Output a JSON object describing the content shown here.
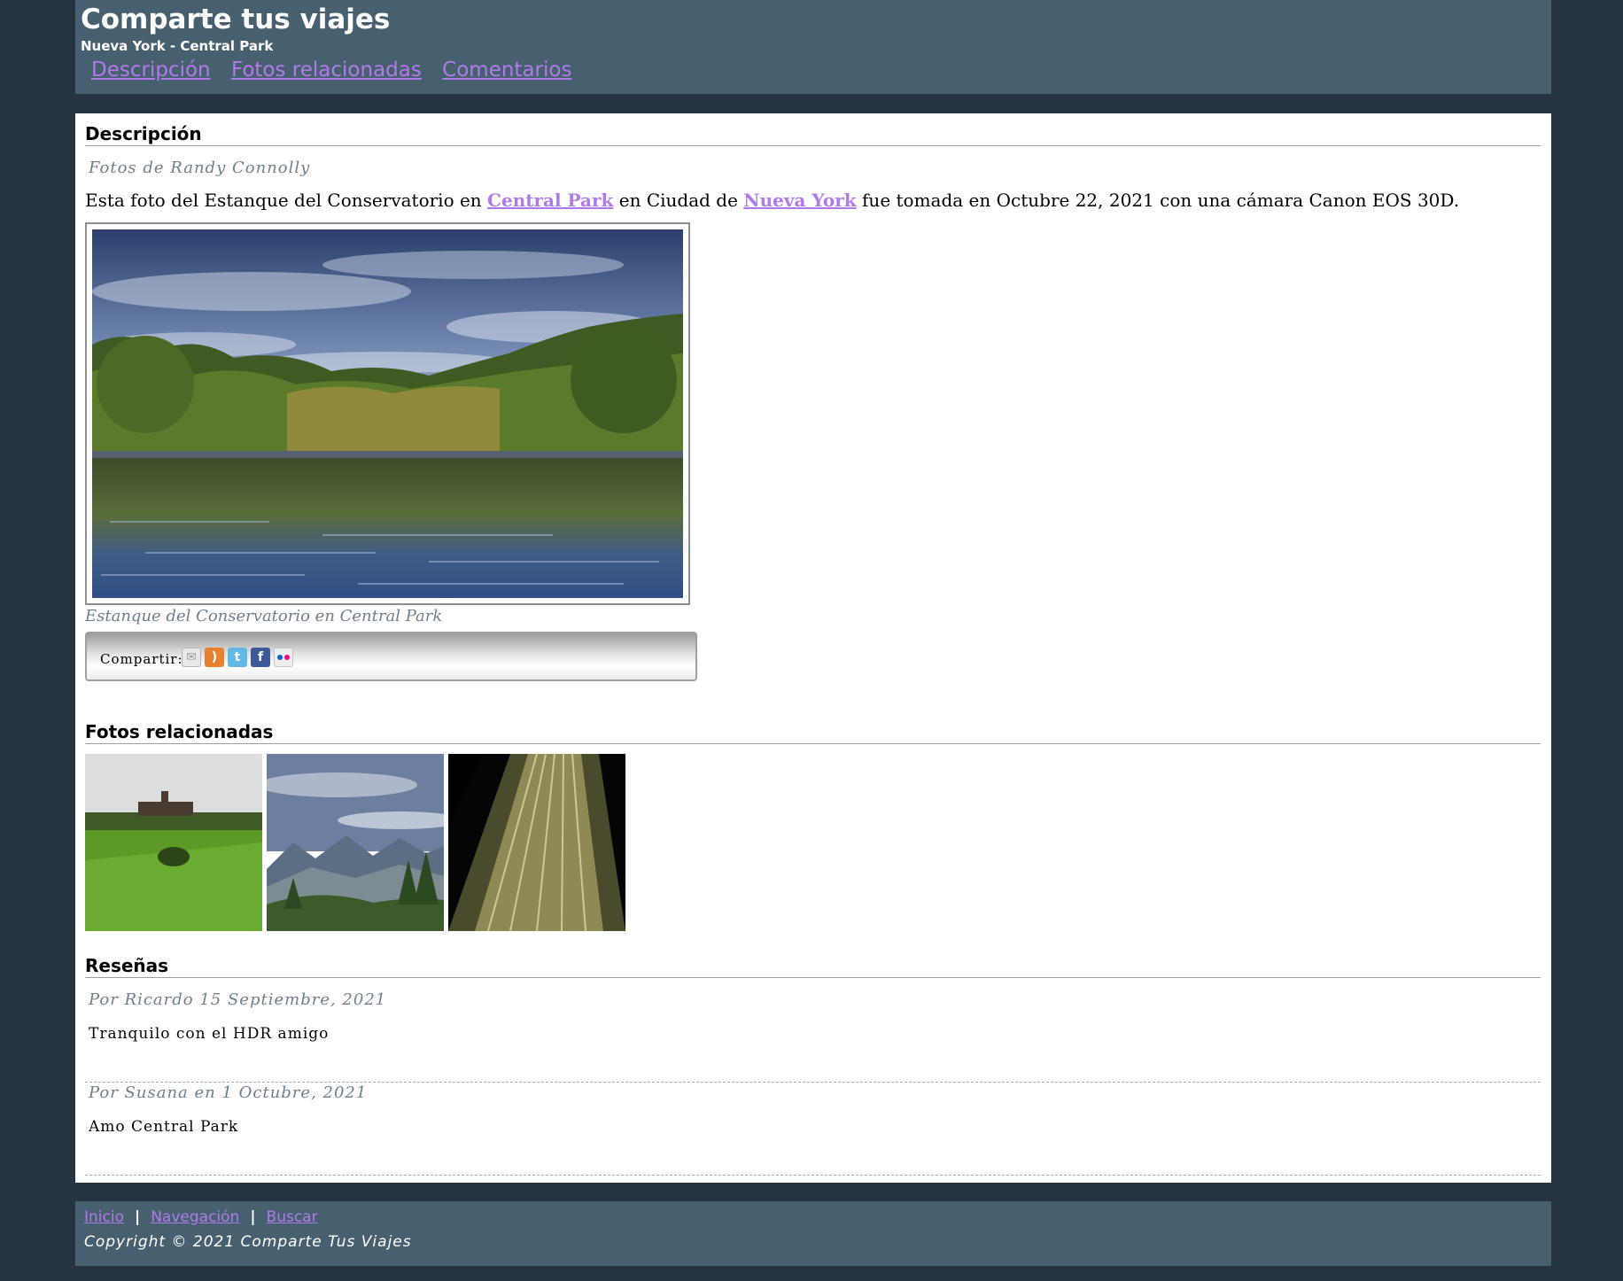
{
  "header": {
    "title": "Comparte tus viajes",
    "subtitle": "Nueva York - Central Park",
    "nav": [
      "Descripción",
      "Fotos relacionadas",
      "Comentarios"
    ]
  },
  "description": {
    "heading": "Descripción",
    "byline": "Fotos de Randy Connolly",
    "text_before": "Esta foto del Estanque del Conservatorio en ",
    "link1": "Central Park",
    "text_middle": " en Ciudad de ",
    "link2": "Nueva York",
    "text_after": " fue tomada en Octubre 22, 2021 con una cámara Canon EOS 30D.",
    "caption": "Estanque del Conservatorio en Central Park",
    "share_label": "Compartir:",
    "share_icons": [
      "email-icon",
      "rss-icon",
      "twitter-icon",
      "facebook-icon",
      "flickr-icon"
    ]
  },
  "related": {
    "heading": "Fotos relacionadas",
    "photos": [
      "field-with-barn",
      "mountain-valley",
      "skyscraper-at-night"
    ]
  },
  "reviews": {
    "heading": "Reseñas",
    "items": [
      {
        "author": "Por Ricardo 15 Septiembre, 2021",
        "text": "Tranquilo con el HDR amigo"
      },
      {
        "author": "Por Susana en 1 Octubre, 2021",
        "text": "Amo Central Park"
      }
    ]
  },
  "footer": {
    "links": [
      "Inicio",
      "Navegación",
      "Buscar"
    ],
    "separator": "|",
    "copyright": "Copyright © 2021 Comparte Tus Viajes"
  },
  "colors": {
    "background": "#263340",
    "header_bg": "#47606f",
    "link": "#b07ae8",
    "muted_text": "#6f7e8c"
  }
}
